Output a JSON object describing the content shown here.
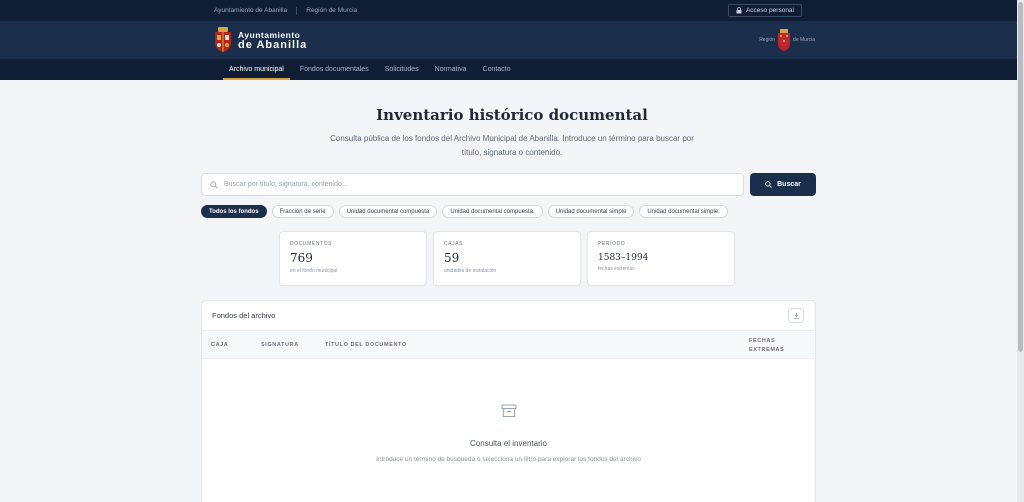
{
  "topbar": {
    "links": [
      "Ayuntamiento de Abanilla",
      "Región de Murcia"
    ],
    "access_label": "Acceso personal",
    "access_icon": "lock-icon"
  },
  "header": {
    "brand_line1": "Ayuntamiento",
    "brand_line2": "de Abanilla",
    "region_left": "Región",
    "region_right": "de Murcia"
  },
  "nav": {
    "items": [
      "Archivo municipal",
      "Fondos documentales",
      "Solicitudes",
      "Normativa",
      "Contacto"
    ],
    "active": "Archivo municipal"
  },
  "main": {
    "title": "Inventario histórico documental",
    "subtitle": "Consulta pública de los fondos del Archivo Municipal de Abanilla. Introduce un término para buscar por título, signatura o contenido."
  },
  "search": {
    "placeholder": "Buscar por título, signatura, contenido...",
    "button_label": "Buscar"
  },
  "filters": [
    "Todos los fondos",
    "Fracción de serie",
    "Unidad documental compuesta",
    "Unidad documental compuesta.",
    "Unidad documental simple",
    "Unidad documental simple."
  ],
  "stats": [
    {
      "label": "DOCUMENTOS",
      "value": "769",
      "sub": "en el fondo municipal"
    },
    {
      "label": "CAJAS",
      "value": "59",
      "sub": "unidades de instalación"
    },
    {
      "label": "PERÍODO",
      "value": "1583–1994",
      "sub": "fechas extremas"
    }
  ],
  "table": {
    "title": "Fondos del archivo",
    "columns": {
      "caja": "CAJA",
      "signatura": "SIGNATURA",
      "titulo": "TÍTULO DEL DOCUMENTO",
      "fechas_1": "FECHAS",
      "fechas_2": "EXTREMAS"
    },
    "empty_title": "Consulta el inventario",
    "empty_desc": "Introduce un término de búsqueda o selecciona un filtro para explorar los fondos del archivo"
  },
  "colors": {
    "navy": "#1b2e4b",
    "dark_navy": "#0f1e35",
    "accent": "#d9a441"
  }
}
